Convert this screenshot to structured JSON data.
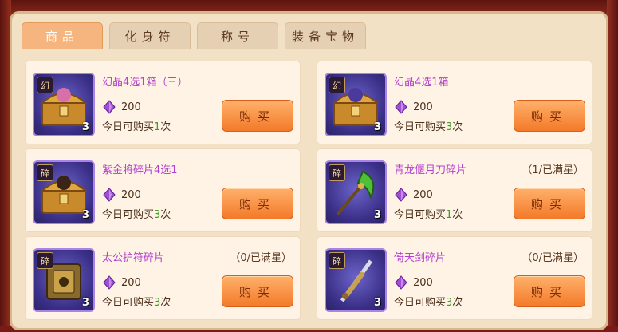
{
  "tabs": [
    {
      "label": "商品",
      "active": true
    },
    {
      "label": "化身符",
      "active": false
    },
    {
      "label": "称号",
      "active": false
    },
    {
      "label": "装备宝物",
      "active": false
    }
  ],
  "items": [
    {
      "name": "幻晶4选1箱（三）",
      "badge": "幻",
      "count": "3",
      "price": "200",
      "limit_prefix": "今日可购买",
      "limit_num": "1",
      "limit_suffix": "次",
      "stars": "",
      "buy": "购买",
      "icon": "treasure-chest-icon"
    },
    {
      "name": "幻晶4选1箱",
      "badge": "幻",
      "count": "3",
      "price": "200",
      "limit_prefix": "今日可购买",
      "limit_num": "3",
      "limit_suffix": "次",
      "stars": "",
      "buy": "购买",
      "icon": "treasure-chest-icon"
    },
    {
      "name": "紫金将碎片4选1",
      "badge": "碎",
      "count": "3",
      "price": "200",
      "limit_prefix": "今日可购买",
      "limit_num": "3",
      "limit_suffix": "次",
      "stars": "",
      "buy": "购买",
      "icon": "treasure-chest-icon"
    },
    {
      "name": "青龙偃月刀碎片",
      "badge": "碎",
      "count": "3",
      "price": "200",
      "limit_prefix": "今日可购买",
      "limit_num": "1",
      "limit_suffix": "次",
      "stars": "（1/已满星）",
      "buy": "购买",
      "icon": "glaive-icon"
    },
    {
      "name": "太公护符碎片",
      "badge": "碎",
      "count": "3",
      "price": "200",
      "limit_prefix": "今日可购买",
      "limit_num": "3",
      "limit_suffix": "次",
      "stars": "（0/已满星）",
      "buy": "购买",
      "icon": "amulet-icon"
    },
    {
      "name": "倚天剑碎片",
      "badge": "碎",
      "count": "3",
      "price": "200",
      "limit_prefix": "今日可购买",
      "limit_num": "3",
      "limit_suffix": "次",
      "stars": "（0/已满星）",
      "buy": "购买",
      "icon": "sword-icon"
    }
  ],
  "colors": {
    "item_name": "#b53fcf",
    "limit_num": "#3f9c21",
    "buy_button": "#f37a2a",
    "gem": "#a24fd8"
  },
  "currency_icon": "purple-gem-icon"
}
